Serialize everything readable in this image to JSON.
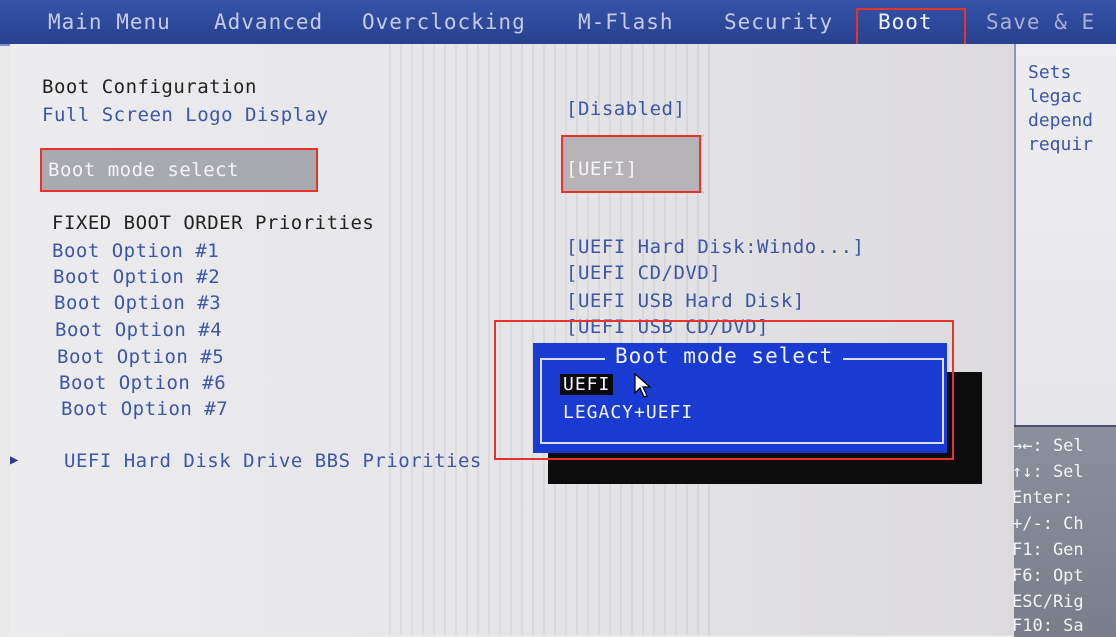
{
  "menu": {
    "tabs": [
      {
        "label": "Main Menu"
      },
      {
        "label": "Advanced"
      },
      {
        "label": "Overclocking"
      },
      {
        "label": "M-Flash"
      },
      {
        "label": "Security"
      },
      {
        "label": "Boot"
      },
      {
        "label": "Save & E"
      }
    ]
  },
  "main": {
    "section_title": "Boot Configuration",
    "full_screen_logo": {
      "label": "Full Screen Logo Display",
      "value": "[Disabled]"
    },
    "boot_mode": {
      "label": "Boot mode select",
      "value": "[UEFI]"
    },
    "fixed_order_title": "FIXED BOOT ORDER Priorities",
    "boot_options": [
      {
        "label": "Boot Option #1",
        "value": "[UEFI Hard Disk:Windo...]"
      },
      {
        "label": "Boot Option #2",
        "value": "[UEFI CD/DVD]"
      },
      {
        "label": "Boot Option #3",
        "value": "[UEFI USB Hard Disk]"
      },
      {
        "label": "Boot Option #4",
        "value": "[UEFI USB CD/DVD]"
      },
      {
        "label": "Boot Option #5",
        "value": ""
      },
      {
        "label": "Boot Option #6",
        "value": ""
      },
      {
        "label": "Boot Option #7",
        "value": ""
      }
    ],
    "bbs_priorities": "UEFI Hard Disk Drive BBS Priorities"
  },
  "popup": {
    "title": "Boot mode select",
    "options": [
      "UEFI",
      "LEGACY+UEFI"
    ],
    "selected": "UEFI"
  },
  "help": {
    "lines": [
      "Sets",
      "legac",
      "depend",
      "requir"
    ],
    "keys": [
      "→←: Sel",
      "↑↓: Sel",
      "Enter:",
      "+/-: Ch",
      "F1: Gen",
      "F6: Opt",
      "ESC/Rig",
      "F10: Sa"
    ]
  },
  "colors": {
    "accent": "#1a3bd2",
    "highlight": "#e8332a",
    "text": "#3c56a8"
  }
}
